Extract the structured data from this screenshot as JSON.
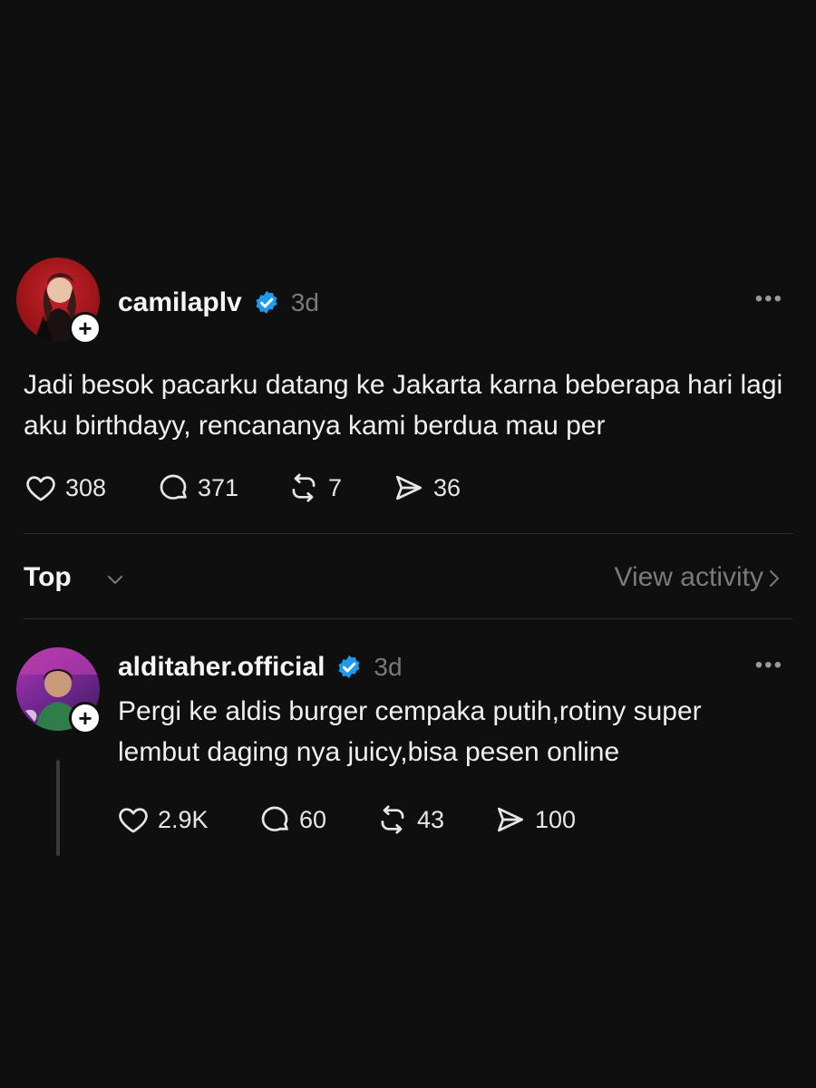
{
  "post": {
    "username": "camilaplv",
    "verified": true,
    "time": "3d",
    "text": "Jadi besok pacarku datang ke Jakarta karna beberapa hari lagi aku birthdayy, rencananya kami berdua mau per",
    "likes": "308",
    "comments": "371",
    "reposts": "7",
    "shares": "36",
    "more_icon": "more-horizontal-icon"
  },
  "sortbar": {
    "sort_label": "Top",
    "view_activity": "View activity"
  },
  "reply": {
    "username": "alditaher.official",
    "verified": true,
    "time": "3d",
    "text": "Pergi ke aldis burger cempaka putih,rotiny super lembut daging nya juicy,bisa pesen online",
    "likes": "2.9K",
    "comments": "60",
    "reposts": "43",
    "shares": "100"
  },
  "colors": {
    "background": "#0f0f10",
    "verified_blue": "#1d9bf0",
    "muted": "#7a7a7a"
  }
}
